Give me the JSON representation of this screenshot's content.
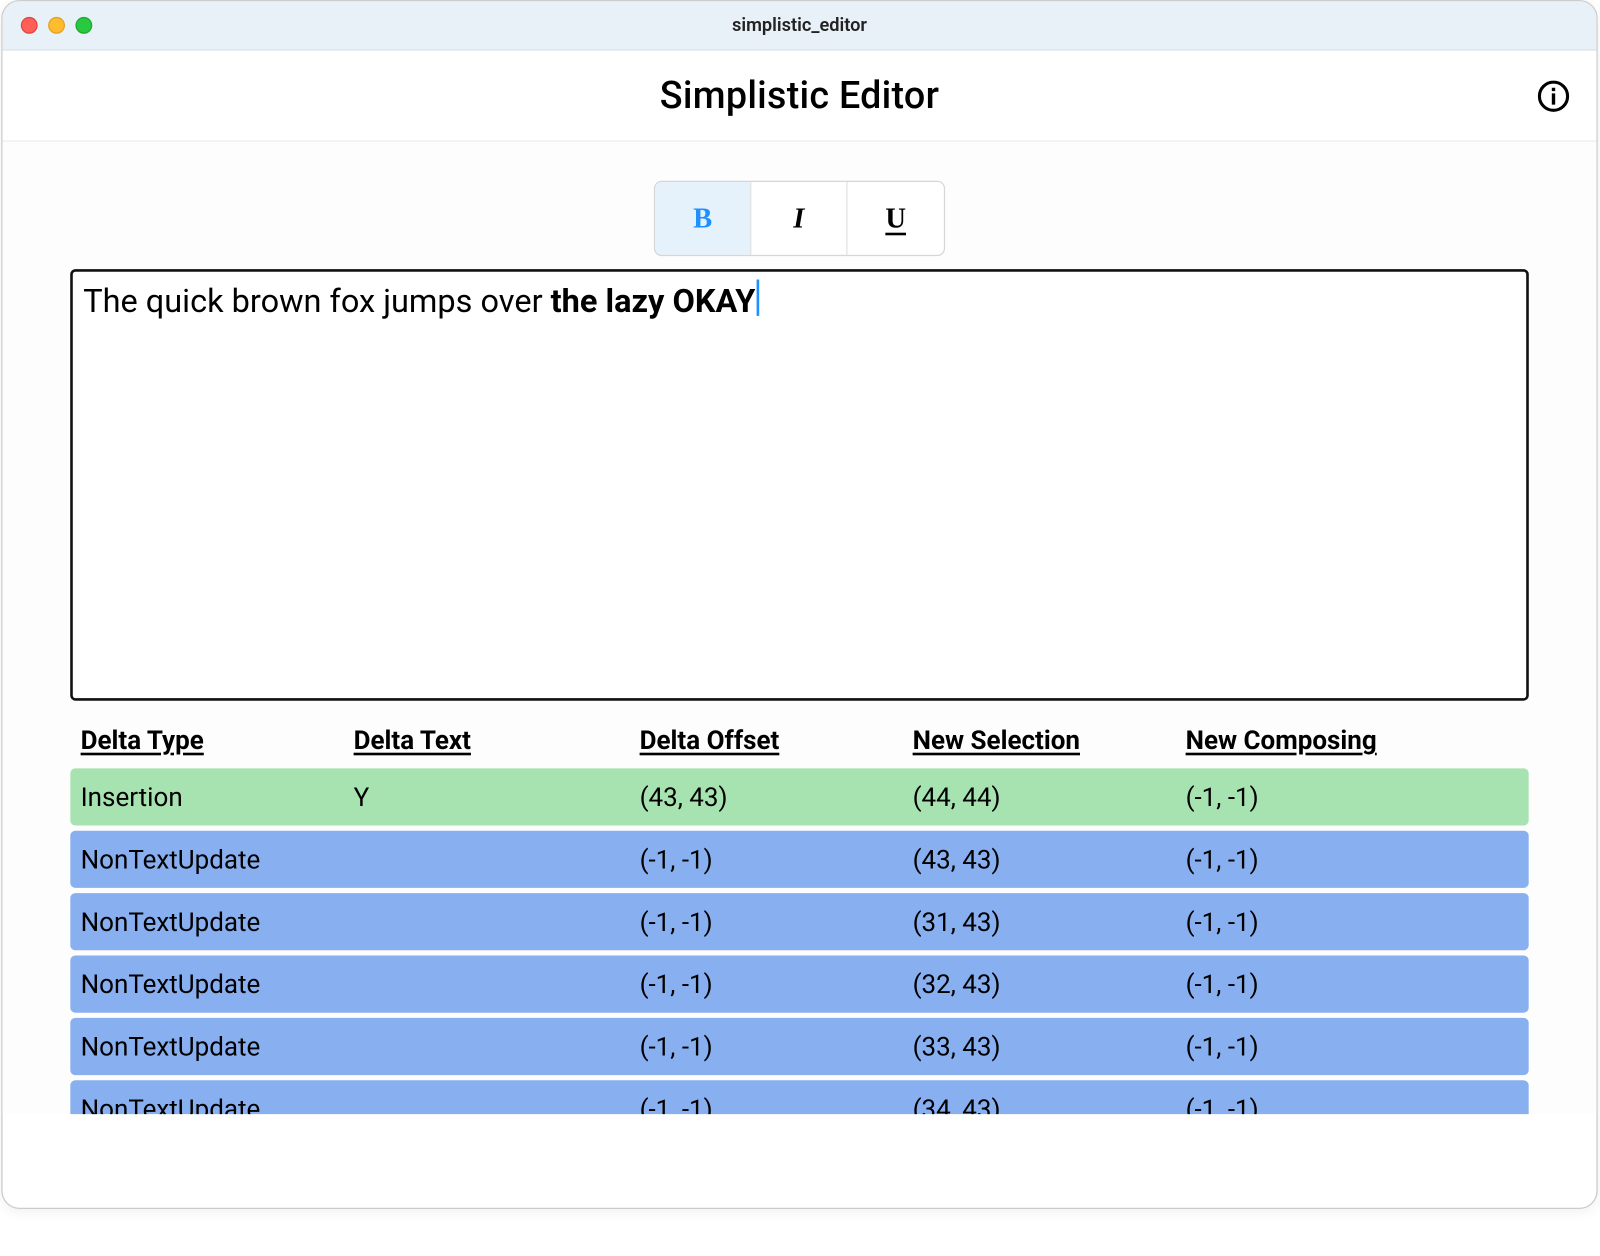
{
  "window": {
    "title": "simplistic_editor"
  },
  "header": {
    "app_title": "Simplistic Editor"
  },
  "formatting": {
    "bold_label": "B",
    "italic_label": "I",
    "underline_label": "U",
    "bold_active": true,
    "italic_active": false,
    "underline_active": false
  },
  "editor": {
    "text_normal": "The quick brown fox jumps over ",
    "text_bold": "the lazy OKAY"
  },
  "table": {
    "headers": {
      "type": "Delta Type",
      "text": "Delta Text",
      "offset": "Delta Offset",
      "selection": "New Selection",
      "composing": "New Composing"
    },
    "rows": [
      {
        "color": "green",
        "type": "Insertion",
        "text": "Y",
        "offset": "(43, 43)",
        "selection": "(44, 44)",
        "composing": "(-1, -1)"
      },
      {
        "color": "blue",
        "type": "NonTextUpdate",
        "text": "",
        "offset": "(-1, -1)",
        "selection": "(43, 43)",
        "composing": "(-1, -1)"
      },
      {
        "color": "blue",
        "type": "NonTextUpdate",
        "text": "",
        "offset": "(-1, -1)",
        "selection": "(31, 43)",
        "composing": "(-1, -1)"
      },
      {
        "color": "blue",
        "type": "NonTextUpdate",
        "text": "",
        "offset": "(-1, -1)",
        "selection": "(32, 43)",
        "composing": "(-1, -1)"
      },
      {
        "color": "blue",
        "type": "NonTextUpdate",
        "text": "",
        "offset": "(-1, -1)",
        "selection": "(33, 43)",
        "composing": "(-1, -1)"
      },
      {
        "color": "blue",
        "type": "NonTextUpdate",
        "text": "",
        "offset": "(-1, -1)",
        "selection": "(34, 43)",
        "composing": "(-1, -1)"
      }
    ]
  }
}
